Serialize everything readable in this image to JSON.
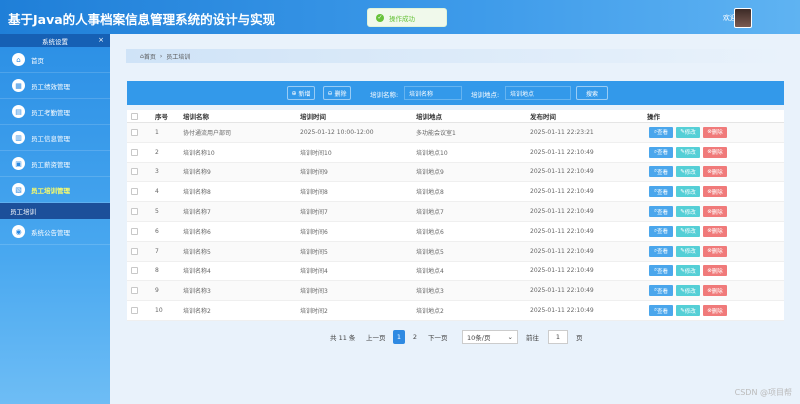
{
  "app": {
    "title": "基于Java的人事档案信息管理系统的设计与实现",
    "welcome": "欢迎 11"
  },
  "toast": {
    "message": "操作成功"
  },
  "sidebar": {
    "header": "系统设置",
    "close": "×",
    "items": [
      {
        "label": "首页",
        "icon": "home-icon",
        "glyph": "⌂"
      },
      {
        "label": "员工绩效管理",
        "icon": "grid-icon",
        "glyph": "▦"
      },
      {
        "label": "员工考勤管理",
        "icon": "calendar-icon",
        "glyph": "▤"
      },
      {
        "label": "员工信息管理",
        "icon": "folder-icon",
        "glyph": "▥"
      },
      {
        "label": "员工薪资管理",
        "icon": "wallet-icon",
        "glyph": "▣"
      },
      {
        "label": "员工培训管理",
        "icon": "training-icon",
        "glyph": "▧"
      }
    ],
    "sub_item": "员工培训",
    "last_item": {
      "label": "系统公告管理",
      "icon": "announcement-icon",
      "glyph": "◉"
    }
  },
  "breadcrumb": {
    "home": "首页",
    "current": "员工培训"
  },
  "search": {
    "add_label": "新增",
    "delete_label": "删除",
    "name_label": "培训名称:",
    "name_placeholder": "培训名称",
    "place_label": "培训地点:",
    "place_placeholder": "培训地点",
    "search_button": "搜索"
  },
  "table": {
    "headers": {
      "no": "序号",
      "name": "培训名称",
      "time": "培训时间",
      "place": "培训地点",
      "pub": "发布时间",
      "op": "操作"
    },
    "ops": {
      "view": "查看",
      "edit": "修改",
      "del": "删除"
    },
    "rows": [
      {
        "no": "1",
        "name": "协付通流用户部司",
        "time": "2025-01-12 10:00-12:00",
        "place": "多功能会议室1",
        "pub": "2025-01-11 22:23:21"
      },
      {
        "no": "2",
        "name": "培训名称10",
        "time": "培训时间10",
        "place": "培训地点10",
        "pub": "2025-01-11 22:10:49"
      },
      {
        "no": "3",
        "name": "培训名称9",
        "time": "培训时间9",
        "place": "培训地点9",
        "pub": "2025-01-11 22:10:49"
      },
      {
        "no": "4",
        "name": "培训名称8",
        "time": "培训时间8",
        "place": "培训地点8",
        "pub": "2025-01-11 22:10:49"
      },
      {
        "no": "5",
        "name": "培训名称7",
        "time": "培训时间7",
        "place": "培训地点7",
        "pub": "2025-01-11 22:10:49"
      },
      {
        "no": "6",
        "name": "培训名称6",
        "time": "培训时间6",
        "place": "培训地点6",
        "pub": "2025-01-11 22:10:49"
      },
      {
        "no": "7",
        "name": "培训名称5",
        "time": "培训时间5",
        "place": "培训地点5",
        "pub": "2025-01-11 22:10:49"
      },
      {
        "no": "8",
        "name": "培训名称4",
        "time": "培训时间4",
        "place": "培训地点4",
        "pub": "2025-01-11 22:10:49"
      },
      {
        "no": "9",
        "name": "培训名称3",
        "time": "培训时间3",
        "place": "培训地点3",
        "pub": "2025-01-11 22:10:49"
      },
      {
        "no": "10",
        "name": "培训名称2",
        "time": "培训时间2",
        "place": "培训地点2",
        "pub": "2025-01-11 22:10:49"
      }
    ]
  },
  "pager": {
    "total": "共 11 条",
    "prev": "上一页",
    "pages": [
      "1",
      "2"
    ],
    "active": "1",
    "next": "下一页",
    "size": "10条/页",
    "goto": "前往",
    "goto_value": "1",
    "page_suffix": "页"
  },
  "watermark": "CSDN @项目帮"
}
